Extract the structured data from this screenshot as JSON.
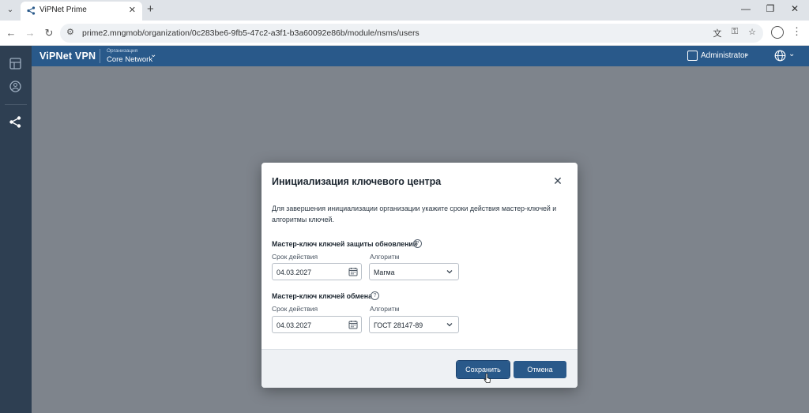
{
  "browser": {
    "tab_title": "ViPNet Prime",
    "tab_close": "✕",
    "new_tab": "+",
    "url": "prime2.mngmob/organization/0c283be6-9fb5-47c2-a3f1-b3a60092e86b/module/nsms/users",
    "window": {
      "minimize": "—",
      "restore": "❐",
      "close": "✕"
    }
  },
  "header": {
    "brand": "ViPNet VPN",
    "org_label": "Организация",
    "org_name": "Core Network",
    "user": "Administrator"
  },
  "modal": {
    "title": "Инициализация ключевого центра",
    "close_glyph": "✕",
    "description": "Для завершения инициализации организации укажите сроки действия мастер-ключей и алгоритмы ключей.",
    "help_glyph": "?",
    "sections": [
      {
        "title": "Мастер-ключ ключей защиты обновлений",
        "validity_label": "Срок действия",
        "validity_value": "04.03.2027",
        "algorithm_label": "Алгоритм",
        "algorithm_value": "Магма"
      },
      {
        "title": "Мастер-ключ ключей обмена",
        "validity_label": "Срок действия",
        "validity_value": "04.03.2027",
        "algorithm_label": "Алгоритм",
        "algorithm_value": "ГОСТ 28147-89"
      }
    ],
    "save_label": "Сохранить",
    "cancel_label": "Отмена"
  },
  "colors": {
    "header_bg": "#29598a",
    "rail_bg": "#2e3f52",
    "backdrop": "#7e848c",
    "button_bg": "#29598a"
  }
}
